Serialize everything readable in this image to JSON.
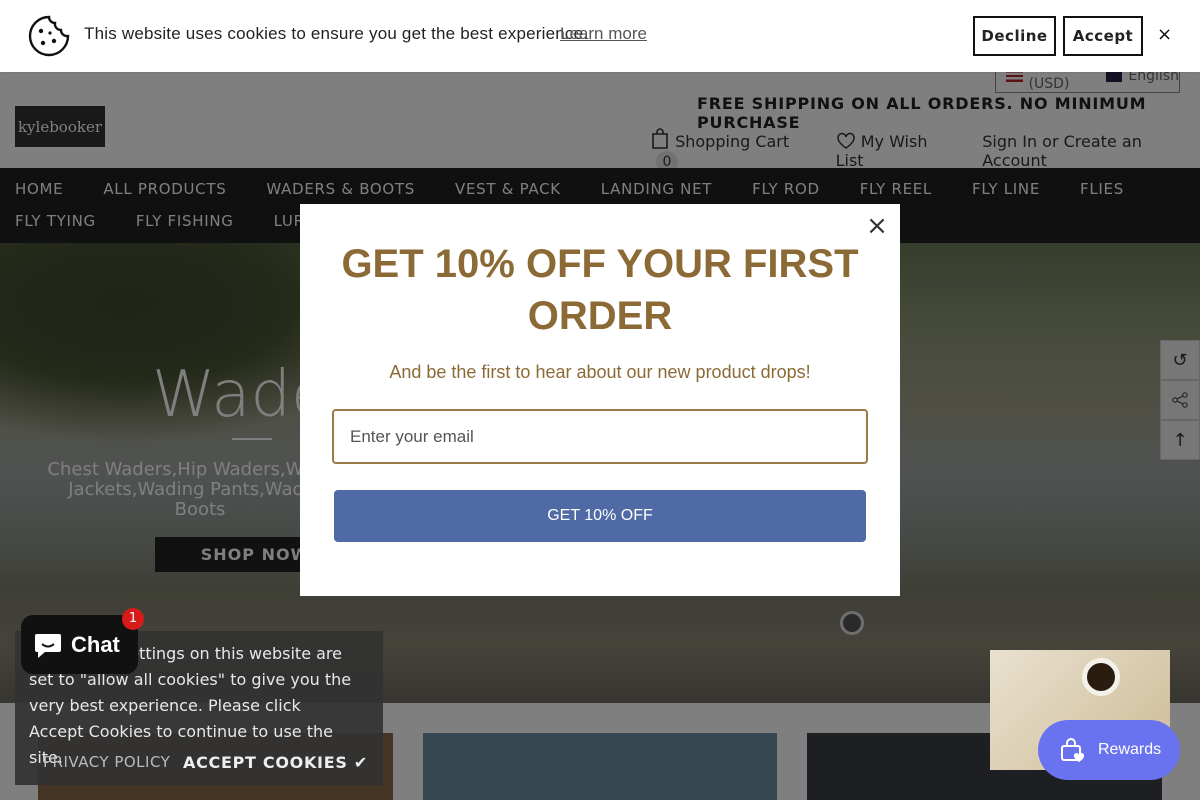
{
  "cookie_banner": {
    "text": "This website uses cookies to ensure you get the best experience.",
    "learn_more": "Learn more",
    "decline": "Decline",
    "accept": "Accept",
    "close": "×"
  },
  "header": {
    "currency": "US (USD)",
    "language": "English",
    "logo": "kylebooker",
    "free_shipping": "FREE SHIPPING ON ALL ORDERS. NO MINIMUM PURCHASE",
    "cart_label": "Shopping Cart",
    "cart_count": "0",
    "wishlist": "My Wish List",
    "account": "Sign In or Create an Account"
  },
  "nav": {
    "row1": [
      "HOME",
      "ALL PRODUCTS",
      "WADERS & BOOTS",
      "VEST & PACK",
      "LANDING NET",
      "FLY ROD",
      "FLY REEL",
      "FLY LINE",
      "FLIES"
    ],
    "row2": [
      "FLY TYING",
      "FLY FISHING",
      "LURE"
    ]
  },
  "hero": {
    "title": "Waders",
    "subtitle": "Chest Waders,Hip Waders,Wading Jackets,Wading Pants,Wading Boots",
    "button": "SHOP NOW"
  },
  "popup": {
    "title": "GET 10% OFF YOUR FIRST ORDER",
    "subtitle": "And be the first to hear about our new product drops!",
    "email_placeholder": "Enter your email",
    "button": "GET 10% OFF",
    "close": "×"
  },
  "cookie_notice": {
    "text": "The cookie settings on this website are set to \"allow all cookies\" to give you the very best experience. Please click Accept Cookies to continue to use the site.",
    "privacy": "PRIVACY POLICY",
    "accept": "ACCEPT COOKIES ✔"
  },
  "chat": {
    "label": "Chat",
    "badge": "1"
  },
  "rewards": {
    "label": "Rewards"
  },
  "colors": {
    "popup_accent": "#8b6a36",
    "popup_button": "#4f6aa5",
    "nav_bg": "#212121",
    "rewards_bg": "#6a73ef"
  }
}
